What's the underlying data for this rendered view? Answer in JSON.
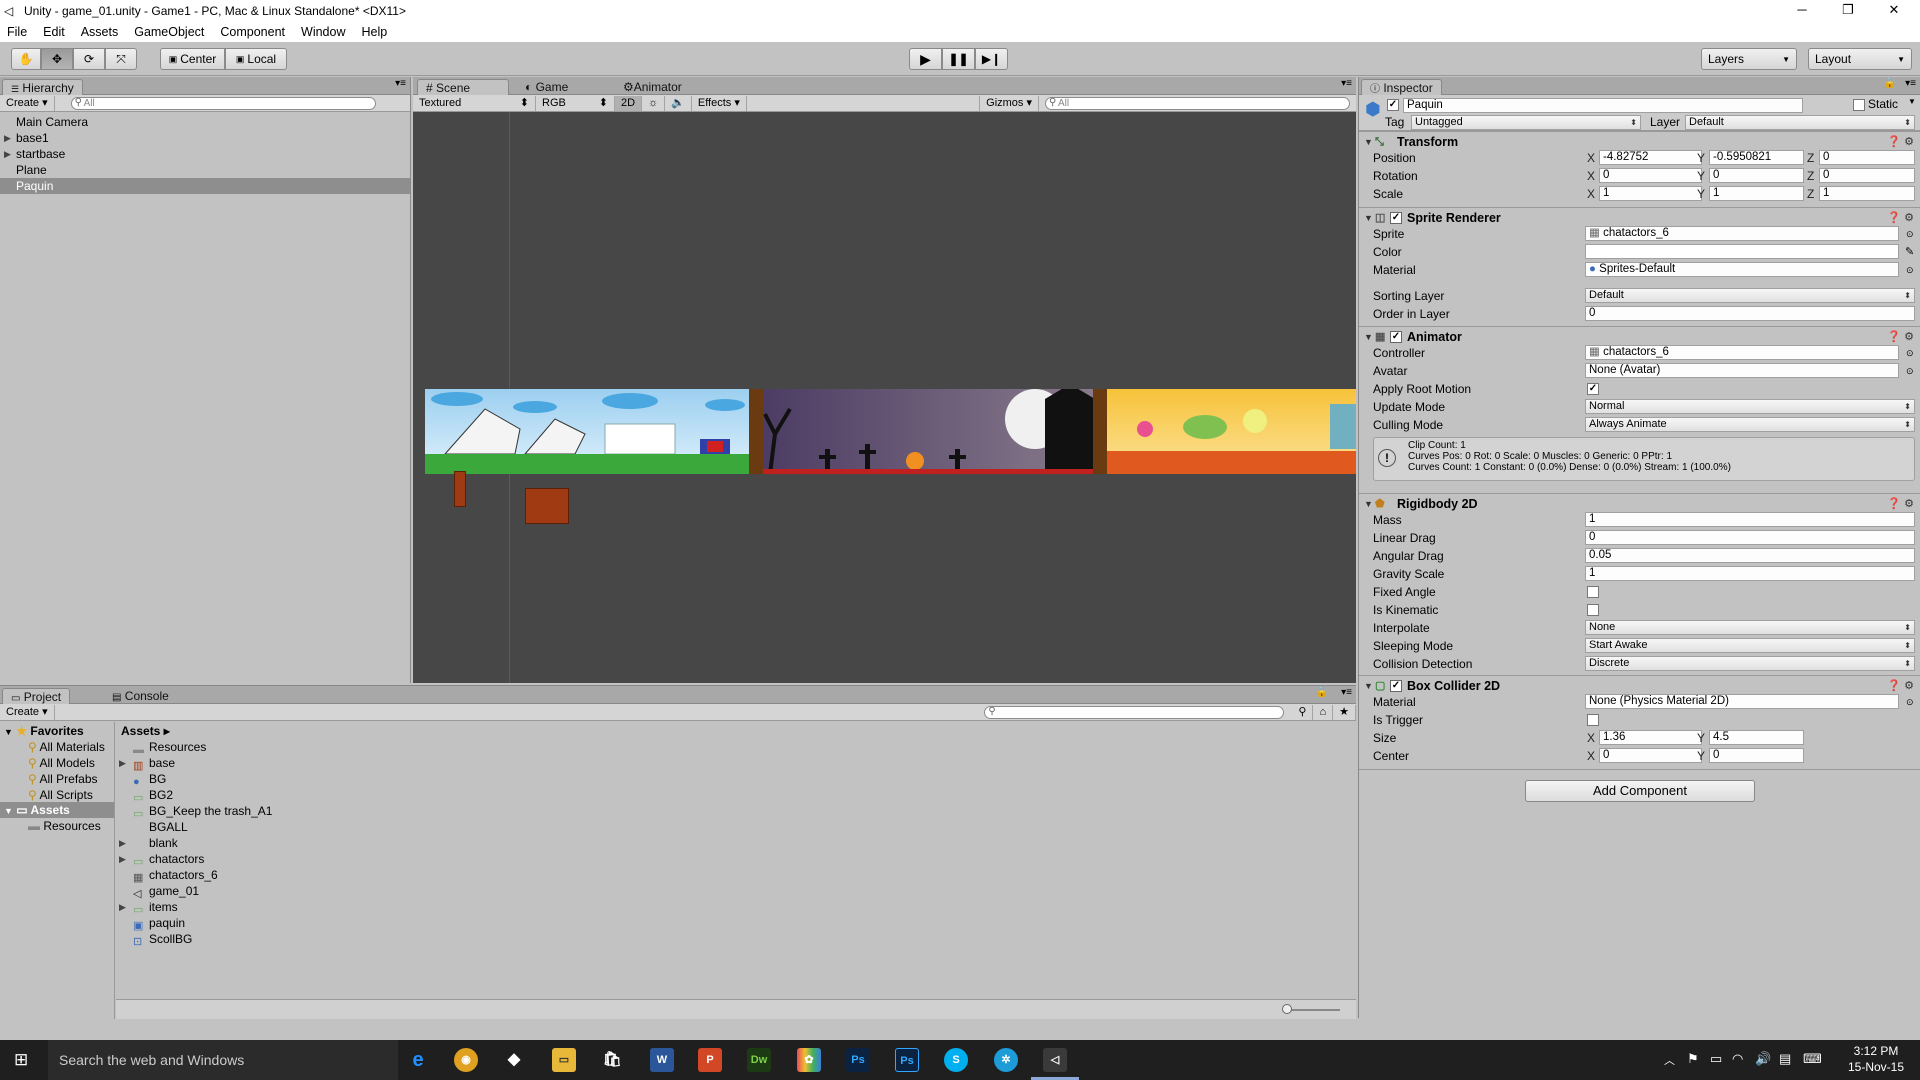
{
  "window": {
    "title": "Unity - game_01.unity - Game1 - PC, Mac & Linux Standalone* <DX11>",
    "controls": [
      "─",
      "❐",
      "✕"
    ]
  },
  "menu": [
    "File",
    "Edit",
    "Assets",
    "GameObject",
    "Component",
    "Window",
    "Help"
  ],
  "toolbar": {
    "pivot": "Center",
    "space": "Local",
    "layers": "Layers",
    "layout": "Layout"
  },
  "hierarchy": {
    "tab": "Hierarchy",
    "create": "Create",
    "search": "All",
    "items": [
      {
        "label": "Main Camera",
        "expand": false,
        "selected": false
      },
      {
        "label": "base1",
        "expand": true,
        "selected": false
      },
      {
        "label": "startbase",
        "expand": true,
        "selected": false
      },
      {
        "label": "Plane",
        "expand": false,
        "selected": false
      },
      {
        "label": "Paquin",
        "expand": false,
        "selected": true
      }
    ]
  },
  "scene": {
    "tabs": [
      "Scene",
      "Game",
      "Animator"
    ],
    "shading": "Textured",
    "channel": "RGB",
    "mode2d": "2D",
    "effects": "Effects",
    "gizmos": "Gizmos",
    "search": "All"
  },
  "project": {
    "tabs": [
      "Project",
      "Console"
    ],
    "create": "Create",
    "favorites_label": "Favorites",
    "favorites": [
      "All Materials",
      "All Models",
      "All Prefabs",
      "All Scripts"
    ],
    "assets_label": "Assets",
    "asset_folders": [
      "Resources"
    ],
    "breadcrumb": "Assets",
    "files": [
      {
        "name": "Resources",
        "icon": "folder",
        "expand": false
      },
      {
        "name": "base",
        "icon": "sprite",
        "expand": true
      },
      {
        "name": "BG",
        "icon": "material",
        "expand": false
      },
      {
        "name": "BG2",
        "icon": "texture",
        "expand": false
      },
      {
        "name": "BG_Keep the trash_A1",
        "icon": "texture",
        "expand": false
      },
      {
        "name": "BGALL",
        "icon": "none",
        "expand": false
      },
      {
        "name": "blank",
        "icon": "none",
        "expand": true
      },
      {
        "name": "chatactors",
        "icon": "texture",
        "expand": true
      },
      {
        "name": "chatactors_6",
        "icon": "animator",
        "expand": false
      },
      {
        "name": "game_01",
        "icon": "unity",
        "expand": false
      },
      {
        "name": "items",
        "icon": "texture",
        "expand": true
      },
      {
        "name": "paquin",
        "icon": "prefab",
        "expand": false
      },
      {
        "name": "ScollBG",
        "icon": "script",
        "expand": false
      }
    ]
  },
  "inspector": {
    "tab": "Inspector",
    "object_name": "Paquin",
    "static_label": "Static",
    "tag_label": "Tag",
    "tag_value": "Untagged",
    "layer_label": "Layer",
    "layer_value": "Default",
    "transform": {
      "title": "Transform",
      "rows": [
        {
          "label": "Position",
          "x": "-4.82752",
          "y": "-0.5950821",
          "z": "0"
        },
        {
          "label": "Rotation",
          "x": "0",
          "y": "0",
          "z": "0"
        },
        {
          "label": "Scale",
          "x": "1",
          "y": "1",
          "z": "1"
        }
      ]
    },
    "sprite_renderer": {
      "title": "Sprite Renderer",
      "sprite_label": "Sprite",
      "sprite": "chatactors_6",
      "color_label": "Color",
      "material_label": "Material",
      "material": "Sprites-Default",
      "sorting_layer_label": "Sorting Layer",
      "sorting_layer": "Default",
      "order_label": "Order in Layer",
      "order": "0"
    },
    "animator": {
      "title": "Animator",
      "controller_label": "Controller",
      "controller": "chatactors_6",
      "avatar_label": "Avatar",
      "avatar": "None (Avatar)",
      "root_motion_label": "Apply Root Motion",
      "update_label": "Update Mode",
      "update": "Normal",
      "culling_label": "Culling Mode",
      "culling": "Always Animate",
      "info": [
        "Clip Count: 1",
        "Curves Pos: 0 Rot: 0 Scale: 0 Muscles: 0 Generic: 0 PPtr: 1",
        "Curves Count: 1 Constant: 0 (0.0%) Dense: 0 (0.0%) Stream: 1 (100.0%)"
      ]
    },
    "rigidbody": {
      "title": "Rigidbody 2D",
      "rows": [
        {
          "label": "Mass",
          "value": "1"
        },
        {
          "label": "Linear Drag",
          "value": "0"
        },
        {
          "label": "Angular Drag",
          "value": "0.05"
        },
        {
          "label": "Gravity Scale",
          "value": "1"
        }
      ],
      "fixed_angle_label": "Fixed Angle",
      "kinematic_label": "Is Kinematic",
      "interpolate_label": "Interpolate",
      "interpolate": "None",
      "sleeping_label": "Sleeping Mode",
      "sleeping": "Start Awake",
      "collision_label": "Collision Detection",
      "collision": "Discrete"
    },
    "box_collider": {
      "title": "Box Collider 2D",
      "material_label": "Material",
      "material": "None (Physics Material 2D)",
      "trigger_label": "Is Trigger",
      "size_label": "Size",
      "size_x": "1.36",
      "size_y": "4.5",
      "center_label": "Center",
      "center_x": "0",
      "center_y": "0"
    },
    "add_component": "Add Component"
  },
  "taskbar": {
    "search": "Search the web and Windows",
    "time": "3:12 PM",
    "date": "15-Nov-15"
  }
}
